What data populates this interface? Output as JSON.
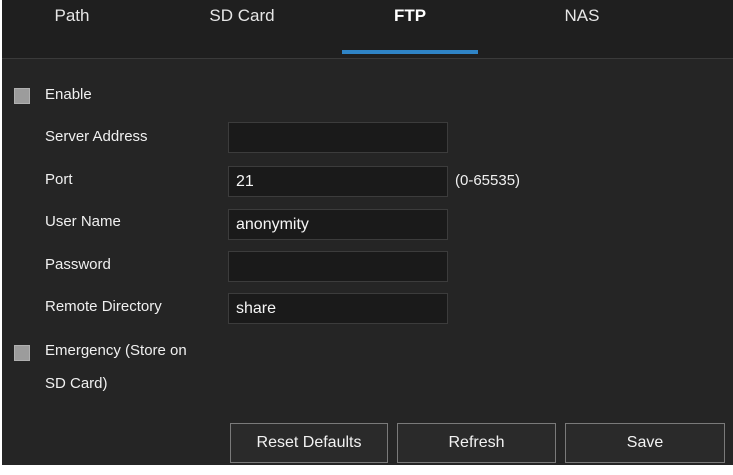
{
  "tabs": [
    {
      "label": "Path",
      "active": false
    },
    {
      "label": "SD Card",
      "active": false
    },
    {
      "label": "FTP",
      "active": true
    },
    {
      "label": "NAS",
      "active": false
    }
  ],
  "colors": {
    "background": "#252525",
    "tab_bar": "#1f1f1f",
    "active_tab_underline": "#2f84c6",
    "field_background": "#1a1a1a",
    "checkbox": "#9c9c9c"
  },
  "form": {
    "enable": {
      "label": "Enable",
      "checked": false
    },
    "server_address": {
      "label": "Server Address",
      "value": ""
    },
    "port": {
      "label": "Port",
      "value": "21",
      "hint": "(0-65535)"
    },
    "user_name": {
      "label": "User Name",
      "value": "anonymity"
    },
    "password": {
      "label": "Password",
      "value": ""
    },
    "remote_directory": {
      "label": "Remote Directory",
      "value": "share"
    },
    "emergency": {
      "label_line1": "Emergency (Store on",
      "label_line2": "SD Card)",
      "checked": false
    }
  },
  "buttons": {
    "reset_defaults": "Reset Defaults",
    "refresh": "Refresh",
    "save": "Save"
  }
}
